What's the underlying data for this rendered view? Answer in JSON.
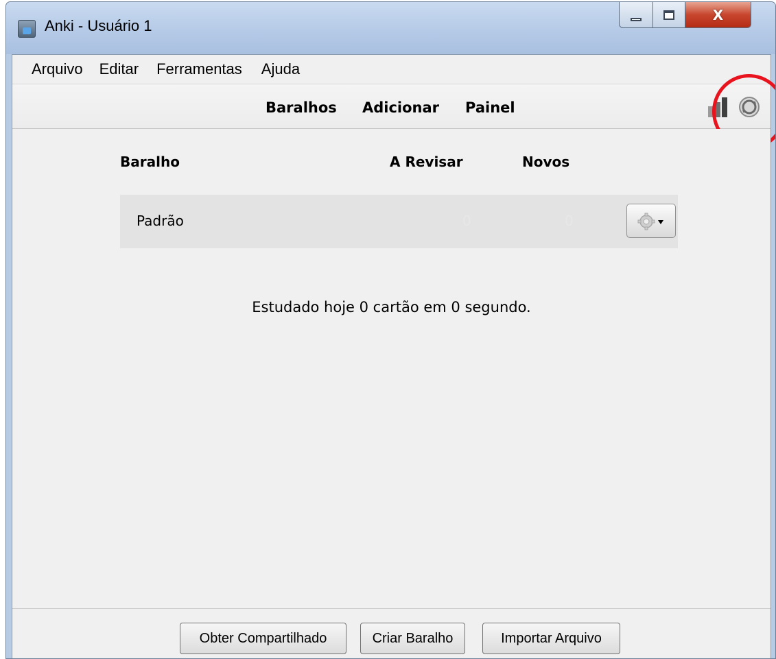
{
  "window": {
    "title": "Anki - Usuário 1",
    "close_glyph": "X"
  },
  "menu": {
    "items": [
      "Arquivo",
      "Editar",
      "Ferramentas",
      "Ajuda"
    ]
  },
  "toolbar": {
    "links": [
      "Baralhos",
      "Adicionar",
      "Painel"
    ],
    "icons": [
      "stats-icon",
      "sync-icon"
    ],
    "highlight_color": "#e8131c"
  },
  "deck_list": {
    "headers": {
      "deck": "Baralho",
      "review": "A Revisar",
      "new": "Novos"
    },
    "rows": [
      {
        "name": "Padrão",
        "review": "0",
        "new": "0"
      }
    ]
  },
  "status": {
    "studied_today": "Estudado hoje 0 cartão em 0 segundo."
  },
  "footer": {
    "buttons": [
      "Obter Compartilhado",
      "Criar Baralho",
      "Importar Arquivo"
    ]
  }
}
